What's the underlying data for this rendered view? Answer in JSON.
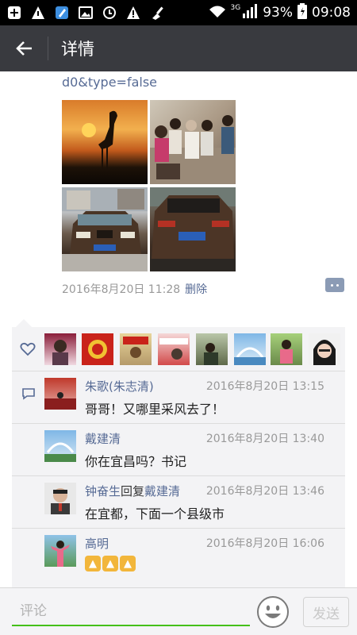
{
  "status_bar": {
    "network": "3G",
    "battery": "93%",
    "time": "09:08"
  },
  "header": {
    "title": "详情"
  },
  "post": {
    "url_fragment": "d0&type=false",
    "timestamp": "2016年8月20日 11:28",
    "delete_label": "删除"
  },
  "comments": [
    {
      "author": "朱歌(朱志清)",
      "time": "2016年8月20日 13:15",
      "text": "哥哥！又哪里采风去了！"
    },
    {
      "author": "戴建清",
      "time": "2016年8月20日 13:40",
      "text": "你在宜昌吗？书记"
    },
    {
      "author": "钟奋生",
      "reply_word": "回复",
      "reply_to": "戴建清",
      "time": "2016年8月20日 13:46",
      "text": "在宜都，下面一个县级市"
    },
    {
      "author": "高明",
      "time": "2016年8月20日 16:06",
      "text": "👍👍👍"
    }
  ],
  "input": {
    "placeholder": "评论",
    "value": ""
  },
  "send_label": "发送",
  "colors": {
    "link": "#576b95",
    "header_bg": "#393a3f",
    "accent_green": "#45c01a"
  }
}
